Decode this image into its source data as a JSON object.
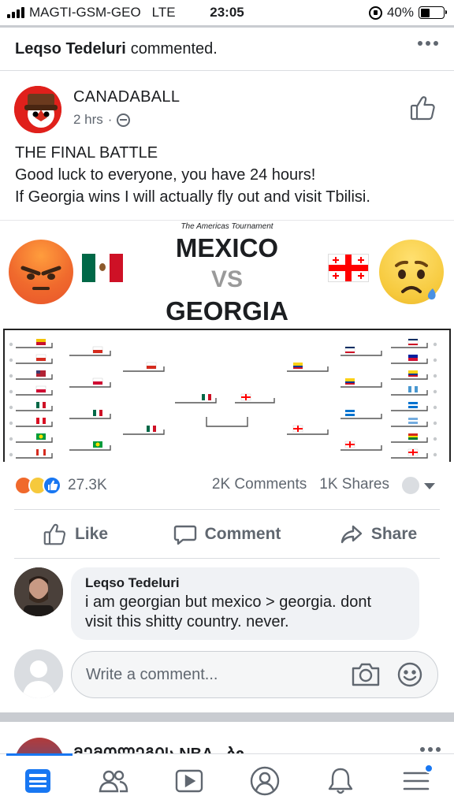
{
  "status_bar": {
    "carrier": "MAGTI-GSM-GEO",
    "network": "LTE",
    "time": "23:05",
    "battery": "40%",
    "battery_level": 0.4
  },
  "story": {
    "actor": "Leqso Tedeluri",
    "action": "commented."
  },
  "post": {
    "page_name": "CANADABALL",
    "time_ago": "2 hrs",
    "separator": "·",
    "text_lines": [
      "THE FINAL BATTLE",
      "Good luck to everyone, you have 24 hours!",
      "If Georgia wins I will actually fly out and visit Tbilisi."
    ],
    "image": {
      "tournament": "The Americas Tournament",
      "team1": "MEXICO",
      "vs": "VS",
      "team2": "GEORGIA"
    }
  },
  "engagement": {
    "reactions_count": "27.3K",
    "comments": "2K Comments",
    "shares": "1K Shares"
  },
  "actions": {
    "like": "Like",
    "comment": "Comment",
    "share": "Share"
  },
  "comment": {
    "author": "Leqso Tedeluri",
    "text_lines": [
      "i am georgian but mexico > georgia. dont",
      "visit this shitty country. never."
    ]
  },
  "composer": {
    "placeholder": "Write a comment..."
  },
  "next_story": {
    "title": "ᲛᲔᲛᲝᲚᲔᲒᲘᲡ NBA - ბი"
  },
  "tabs": [
    "news-feed",
    "friends",
    "watch",
    "profile",
    "notifications",
    "menu"
  ],
  "colors": {
    "accent": "#1877f2",
    "text": "#1c1e21",
    "muted": "#606770",
    "flag_mexico": [
      "#006847",
      "#ffffff",
      "#ce1126"
    ],
    "flag_georgia": [
      "#ffffff",
      "#ff0000"
    ]
  }
}
